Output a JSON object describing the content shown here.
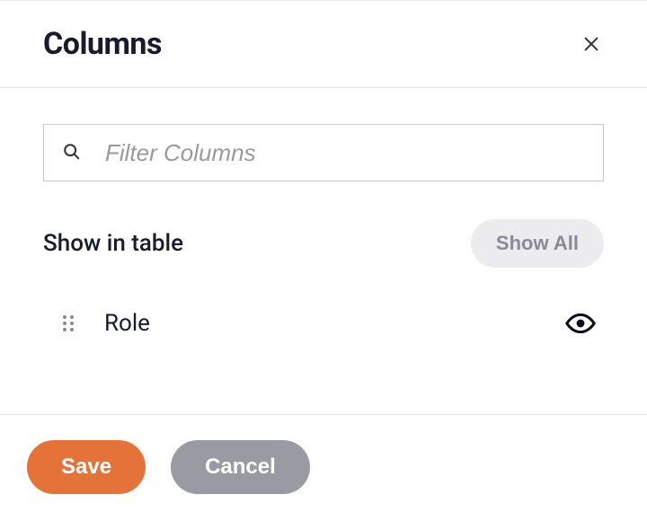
{
  "header": {
    "title": "Columns"
  },
  "search": {
    "placeholder": "Filter Columns",
    "value": ""
  },
  "section": {
    "label": "Show in table",
    "show_all_label": "Show All"
  },
  "columns": [
    {
      "name": "Role",
      "visible": true
    }
  ],
  "footer": {
    "save_label": "Save",
    "cancel_label": "Cancel"
  },
  "colors": {
    "accent": "#e57339",
    "muted": "#9a9aa2"
  }
}
